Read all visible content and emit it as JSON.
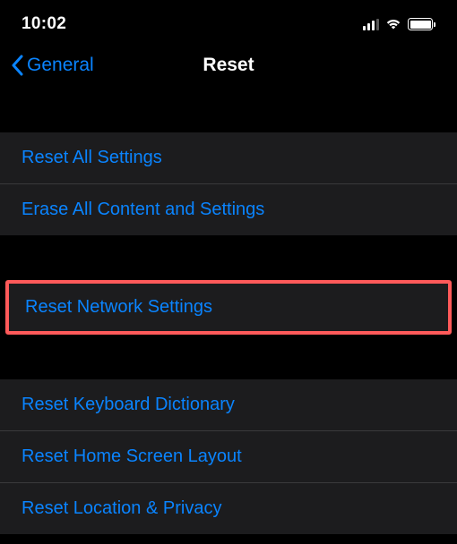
{
  "statusBar": {
    "time": "10:02"
  },
  "navBar": {
    "backLabel": "General",
    "title": "Reset"
  },
  "group1": {
    "items": [
      {
        "label": "Reset All Settings"
      },
      {
        "label": "Erase All Content and Settings"
      }
    ]
  },
  "highlighted": {
    "label": "Reset Network Settings"
  },
  "group2": {
    "items": [
      {
        "label": "Reset Keyboard Dictionary"
      },
      {
        "label": "Reset Home Screen Layout"
      },
      {
        "label": "Reset Location & Privacy"
      }
    ]
  }
}
